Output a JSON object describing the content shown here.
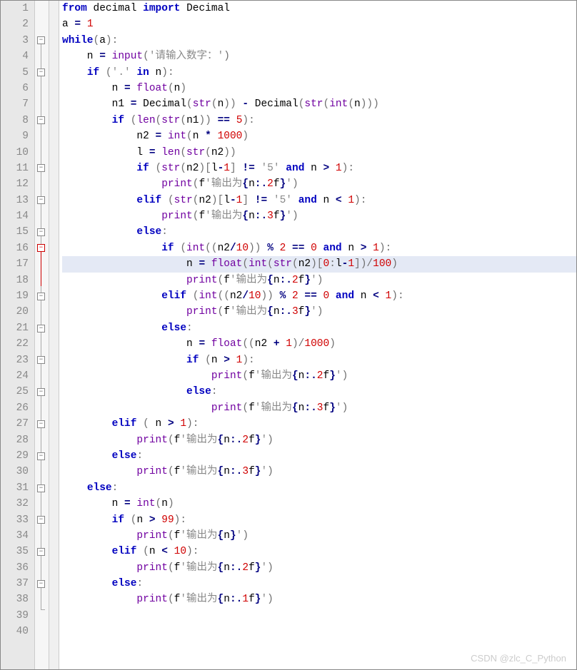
{
  "watermark": "CSDN @zlc_C_Python",
  "lines": [
    "1",
    "2",
    "3",
    "4",
    "5",
    "6",
    "7",
    "8",
    "9",
    "10",
    "11",
    "12",
    "13",
    "14",
    "15",
    "16",
    "17",
    "18",
    "19",
    "20",
    "21",
    "22",
    "23",
    "24",
    "25",
    "26",
    "27",
    "28",
    "29",
    "30",
    "31",
    "32",
    "33",
    "34",
    "35",
    "36",
    "37",
    "38",
    "39",
    "40"
  ],
  "code": {
    "l1": {
      "a": "from ",
      "b": "decimal ",
      "c": "import ",
      "d": "Decimal"
    },
    "l2": {
      "a": "a ",
      "b": "= ",
      "c": "1"
    },
    "l3": {
      "a": "while",
      "b": "(",
      "c": "a",
      "d": "):"
    },
    "l4": {
      "a": "    n ",
      "b": "= ",
      "c": "input",
      "d": "(",
      "e": "'请输入数字：'",
      "f": ")"
    },
    "l5": {
      "a": "    ",
      "b": "if ",
      "c": "(",
      "d": "'.' ",
      "e": "in ",
      "f": "n",
      "g": "):"
    },
    "l6": {
      "a": "        n ",
      "b": "= ",
      "c": "float",
      "d": "(",
      "e": "n",
      "f": ")"
    },
    "l7": {
      "a": "        n1 ",
      "b": "= ",
      "c": "Decimal",
      "d": "(",
      "e": "str",
      "f": "(",
      "g": "n",
      "h": ")) ",
      "i": "- ",
      "j": "Decimal",
      "k": "(",
      "l": "str",
      "m": "(",
      "n": "int",
      "o": "(",
      "p": "n",
      "q": ")))"
    },
    "l8": {
      "a": "        ",
      "b": "if ",
      "c": "(",
      "d": "len",
      "e": "(",
      "f": "str",
      "g": "(",
      "h": "n1",
      "i": ")) ",
      "j": "== ",
      "k": "5",
      "l": "):"
    },
    "l9": {
      "a": "            n2 ",
      "b": "= ",
      "c": "int",
      "d": "(",
      "e": "n ",
      "f": "* ",
      "g": "1000",
      "h": ")"
    },
    "l10": {
      "a": "            l ",
      "b": "= ",
      "c": "len",
      "d": "(",
      "e": "str",
      "f": "(",
      "g": "n2",
      "h": "))"
    },
    "l11": {
      "a": "            ",
      "b": "if ",
      "c": "(",
      "d": "str",
      "e": "(",
      "f": "n2",
      "g": ")[",
      "h": "l",
      "i": "-",
      "j": "1",
      "k": "] ",
      "l": "!= ",
      "m": "'5' ",
      "n": "and ",
      "o": "n ",
      "p": "> ",
      "q": "1",
      "r": "):"
    },
    "l12": {
      "a": "                ",
      "b": "print",
      "c": "(",
      "d": "f",
      "e": "'输出为",
      "f": "{",
      "g": "n",
      "h": ":.",
      "i": "2",
      "j": "f",
      "k": "}",
      "l": "'",
      "m": ")"
    },
    "l13": {
      "a": "            ",
      "b": "elif ",
      "c": "(",
      "d": "str",
      "e": "(",
      "f": "n2",
      "g": ")[",
      "h": "l",
      "i": "-",
      "j": "1",
      "k": "] ",
      "l": "!= ",
      "m": "'5' ",
      "n": "and ",
      "o": "n ",
      "p": "< ",
      "q": "1",
      "r": "):"
    },
    "l14": {
      "a": "                ",
      "b": "print",
      "c": "(",
      "d": "f",
      "e": "'输出为",
      "f": "{",
      "g": "n",
      "h": ":.",
      "i": "3",
      "j": "f",
      "k": "}",
      "l": "'",
      "m": ")"
    },
    "l15": {
      "a": "            ",
      "b": "else",
      "c": ":"
    },
    "l16": {
      "a": "                ",
      "b": "if ",
      "c": "(",
      "d": "int",
      "e": "((",
      "f": "n2",
      "g": "/",
      "h": "10",
      "i": ")) ",
      "j": "% ",
      "k": "2 ",
      "l": "== ",
      "m": "0 ",
      "n": "and ",
      "o": "n ",
      "p": "> ",
      "q": "1",
      "r": "):"
    },
    "l17": {
      "a": "                    n ",
      "b": "= ",
      "c": "float",
      "d": "(",
      "e": "int",
      "f": "(",
      "g": "str",
      "h": "(",
      "i": "n2",
      "j": ")[",
      "k": "0",
      "l": ":",
      "m": "l",
      "n": "-",
      "o": "1",
      "p": "])/",
      "q": "100",
      "r": ")"
    },
    "l18": {
      "a": "                    ",
      "b": "print",
      "c": "(",
      "d": "f",
      "e": "'输出为",
      "f": "{",
      "g": "n",
      "h": ":.",
      "i": "2",
      "j": "f",
      "k": "}",
      "l": "'",
      "m": ")"
    },
    "l19": {
      "a": "                ",
      "b": "elif ",
      "c": "(",
      "d": "int",
      "e": "((",
      "f": "n2",
      "g": "/",
      "h": "10",
      "i": ")) ",
      "j": "% ",
      "k": "2 ",
      "l": "== ",
      "m": "0 ",
      "n": "and ",
      "o": "n ",
      "p": "< ",
      "q": "1",
      "r": "):"
    },
    "l20": {
      "a": "                    ",
      "b": "print",
      "c": "(",
      "d": "f",
      "e": "'输出为",
      "f": "{",
      "g": "n",
      "h": ":.",
      "i": "3",
      "j": "f",
      "k": "}",
      "l": "'",
      "m": ")"
    },
    "l21": {
      "a": "                ",
      "b": "else",
      "c": ":"
    },
    "l22": {
      "a": "                    n ",
      "b": "= ",
      "c": "float",
      "d": "((",
      "e": "n2 ",
      "f": "+ ",
      "g": "1",
      "h": ")/",
      "i": "1000",
      "j": ")"
    },
    "l23": {
      "a": "                    ",
      "b": "if ",
      "c": "(",
      "d": "n ",
      "e": "> ",
      "f": "1",
      "g": "):"
    },
    "l24": {
      "a": "                        ",
      "b": "print",
      "c": "(",
      "d": "f",
      "e": "'输出为",
      "f": "{",
      "g": "n",
      "h": ":.",
      "i": "2",
      "j": "f",
      "k": "}",
      "l": "'",
      "m": ")"
    },
    "l25": {
      "a": "                    ",
      "b": "else",
      "c": ":"
    },
    "l26": {
      "a": "                        ",
      "b": "print",
      "c": "(",
      "d": "f",
      "e": "'输出为",
      "f": "{",
      "g": "n",
      "h": ":.",
      "i": "3",
      "j": "f",
      "k": "}",
      "l": "'",
      "m": ")"
    },
    "l27": {
      "a": "        ",
      "b": "elif ",
      "c": "( ",
      "d": "n ",
      "e": "> ",
      "f": "1",
      "g": "):"
    },
    "l28": {
      "a": "            ",
      "b": "print",
      "c": "(",
      "d": "f",
      "e": "'输出为",
      "f": "{",
      "g": "n",
      "h": ":.",
      "i": "2",
      "j": "f",
      "k": "}",
      "l": "'",
      "m": ")"
    },
    "l29": {
      "a": "        ",
      "b": "else",
      "c": ":"
    },
    "l30": {
      "a": "            ",
      "b": "print",
      "c": "(",
      "d": "f",
      "e": "'输出为",
      "f": "{",
      "g": "n",
      "h": ":.",
      "i": "3",
      "j": "f",
      "k": "}",
      "l": "'",
      "m": ")"
    },
    "l31": {
      "a": "    ",
      "b": "else",
      "c": ":"
    },
    "l32": {
      "a": "        n ",
      "b": "= ",
      "c": "int",
      "d": "(",
      "e": "n",
      "f": ")"
    },
    "l33": {
      "a": "        ",
      "b": "if ",
      "c": "(",
      "d": "n ",
      "e": "> ",
      "f": "99",
      "g": "):"
    },
    "l34": {
      "a": "            ",
      "b": "print",
      "c": "(",
      "d": "f",
      "e": "'输出为",
      "f": "{",
      "g": "n",
      "h": "}",
      "i": "'",
      "j": ")"
    },
    "l35": {
      "a": "        ",
      "b": "elif ",
      "c": "(",
      "d": "n ",
      "e": "< ",
      "f": "10",
      "g": "):"
    },
    "l36": {
      "a": "            ",
      "b": "print",
      "c": "(",
      "d": "f",
      "e": "'输出为",
      "f": "{",
      "g": "n",
      "h": ":.",
      "i": "2",
      "j": "f",
      "k": "}",
      "l": "'",
      "m": ")"
    },
    "l37": {
      "a": "        ",
      "b": "else",
      "c": ":"
    },
    "l38": {
      "a": "            ",
      "b": "print",
      "c": "(",
      "d": "f",
      "e": "'输出为",
      "f": "{",
      "g": "n",
      "h": ":.",
      "i": "1",
      "j": "f",
      "k": "}",
      "l": "'",
      "m": ")"
    }
  }
}
